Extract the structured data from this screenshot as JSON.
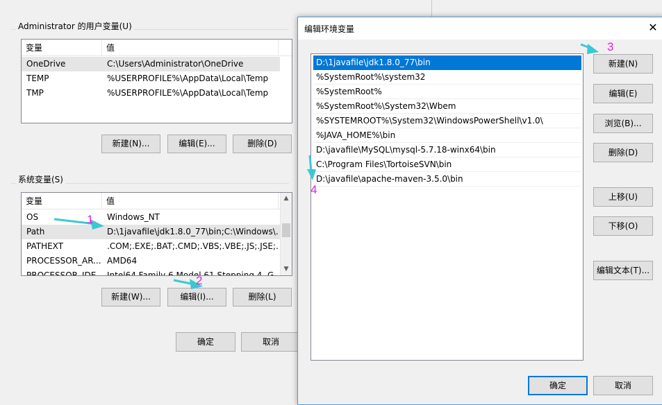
{
  "user_vars": {
    "group_label": "Administrator 的用户变量(U)",
    "headers": [
      "变量",
      "值"
    ],
    "rows": [
      {
        "name": "OneDrive",
        "value": "C:\\Users\\Administrator\\OneDrive"
      },
      {
        "name": "TEMP",
        "value": "%USERPROFILE%\\AppData\\Local\\Temp"
      },
      {
        "name": "TMP",
        "value": "%USERPROFILE%\\AppData\\Local\\Temp"
      }
    ],
    "buttons": {
      "new": "新建(N)...",
      "edit": "编辑(E)...",
      "delete": "删除(D)"
    }
  },
  "system_vars": {
    "group_label": "系统变量(S)",
    "headers": [
      "变量",
      "值"
    ],
    "rows": [
      {
        "name": "OS",
        "value": "Windows_NT"
      },
      {
        "name": "Path",
        "value": "D:\\1javafile\\jdk1.8.0_77\\bin;C:\\Windows\\..."
      },
      {
        "name": "PATHEXT",
        "value": ".COM;.EXE;.BAT;.CMD;.VBS;.VBE;.JS;.JSE;..."
      },
      {
        "name": "PROCESSOR_AR...",
        "value": "AMD64"
      },
      {
        "name": "PROCESSOR_IDE...",
        "value": "Intel64 Family 6 Model 61 Stepping 4, G..."
      }
    ],
    "buttons": {
      "new": "新建(W)...",
      "edit": "编辑(I)...",
      "delete": "删除(L)"
    }
  },
  "left_footer": {
    "ok": "确定",
    "cancel": "取消"
  },
  "edit_dialog": {
    "title": "编辑环境变量",
    "close_glyph": "✕",
    "paths": [
      "D:\\1javafile\\jdk1.8.0_77\\bin",
      "%SystemRoot%\\system32",
      "%SystemRoot%",
      "%SystemRoot%\\System32\\Wbem",
      "%SYSTEMROOT%\\System32\\WindowsPowerShell\\v1.0\\",
      "%JAVA_HOME%\\bin",
      "D:\\javafile\\MySQL\\mysql-5.7.18-winx64\\bin",
      "C:\\Program Files\\TortoiseSVN\\bin",
      "D:\\javafile\\apache-maven-3.5.0\\bin"
    ],
    "buttons": {
      "new": "新建(N)",
      "edit": "编辑(E)",
      "browse": "浏览(B)...",
      "delete": "删除(D)",
      "move_up": "上移(U)",
      "move_down": "下移(O)",
      "edit_text": "编辑文本(T)...",
      "ok": "确定",
      "cancel": "取消"
    }
  },
  "annotations": {
    "n1": "1",
    "n2": "2",
    "n3": "3",
    "n4": "4"
  },
  "colors": {
    "arrow": "#3cc8d2",
    "annotation_text": "#e020e0",
    "selection": "#0078d7"
  }
}
